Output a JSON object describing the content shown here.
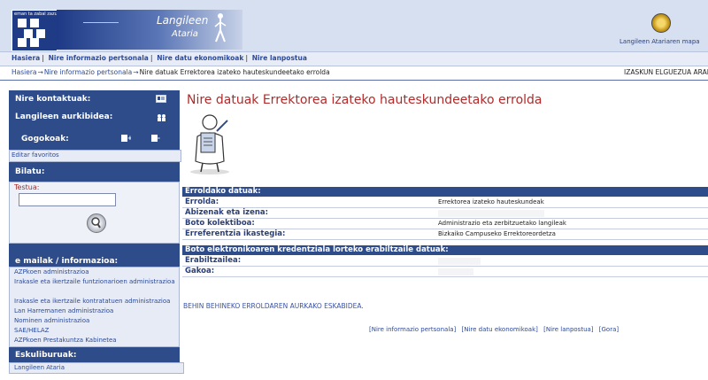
{
  "header": {
    "logo_small_text": "eman ta zabal zazu",
    "banner_line1": "Langileen",
    "banner_line2": "Ataria",
    "map_label": "Langileen Atariaren mapa"
  },
  "topnav": [
    "Hasiera",
    "Nire informazio pertsonala",
    "Nire datu ekonomikoak",
    "Nire lanpostua"
  ],
  "breadcrumb": {
    "items": [
      "Hasiera",
      "Nire informazio pertsonala",
      "Nire datuak Errektorea izateko hauteskundeetako errolda"
    ],
    "user": "IZASKUN ELGUEZUA ARANC"
  },
  "sidebar": {
    "contacts": "Nire kontaktuak:",
    "presence": "Langileen aurkibidea:",
    "bookmarks": "Gogokoak:",
    "edit_favorites": "Editar favoritos",
    "search_title": "Bilatu:",
    "search_label": "Testua:",
    "search_value": "",
    "email_title": "e mailak / informazioa:",
    "email_items": [
      "AZPkoen administrazioa",
      "Irakasle eta ikertzaile funtzionarioen administrazioa",
      "Irakasle eta ikertzaile kontratatuen administrazioa",
      "Lan Harremanen administrazioa",
      "Nominen administrazioa",
      "SAE/HELAZ",
      "AZPkoen Prestakuntza Kabinetea"
    ],
    "manuals_title": "Eskuliburuak:",
    "manual_item": "Langileen Ataria"
  },
  "main": {
    "title": "Nire datuak Errektorea izateko hauteskundeetako errolda",
    "section1": "Erroldako datuak:",
    "rows1": [
      {
        "label": "Errolda:",
        "value": "Errektorea izateko hauteskundeak"
      },
      {
        "label": "Abizenak eta izena:",
        "value": ""
      },
      {
        "label": "Boto kolektiboa:",
        "value": "Administrazio eta zerbitzuetako langileak"
      },
      {
        "label": "Erreferentzia ikastegia:",
        "value": "Bizkaiko Campuseko Errektoreordetza"
      }
    ],
    "section2": "Boto elektronikoaren kredentziala lorteko erabiltzaile datuak:",
    "rows2": [
      {
        "label": "Erabiltzailea:",
        "value": ""
      },
      {
        "label": "Gakoa:",
        "value": ""
      }
    ],
    "appeal": "BEHIN BEHINEKO ERROLDAREN AURKAKO ESKABIDEA.",
    "footer_links": [
      "[Nire informazio pertsonala]",
      "[Nire datu ekonomikoak]",
      "[Nire lanpostua]",
      "[Gora]"
    ]
  },
  "colors": {
    "navy": "#2f4c8a",
    "title_red": "#b22a2a",
    "link_blue": "#2c4a98",
    "header_bg": "#d7e0f0"
  }
}
